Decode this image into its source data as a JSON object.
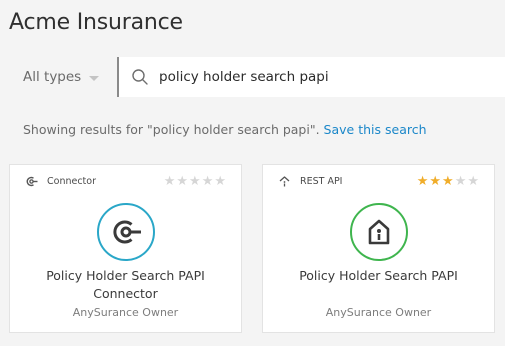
{
  "header": {
    "title": "Acme Insurance"
  },
  "filter": {
    "type_label": "All types"
  },
  "search": {
    "value": "policy holder search papi"
  },
  "results": {
    "prefix": "Showing results for \"policy holder search papi\". ",
    "save_label": "Save this search"
  },
  "cards": [
    {
      "type": "Connector",
      "type_icon": "connector-icon",
      "rating": 0,
      "max_rating": 5,
      "accent": "#2aa7c8",
      "name": "Policy Holder Search PAPI Connector",
      "owner": "AnySurance Owner"
    },
    {
      "type": "REST API",
      "type_icon": "rest-api-icon",
      "rating": 3,
      "max_rating": 5,
      "accent": "#3fb54e",
      "name": "Policy Holder Search PAPI",
      "owner": "AnySurance Owner"
    }
  ],
  "colors": {
    "link": "#1b87c9",
    "star_filled": "#f0ad2a",
    "star_empty": "#d6d6d6"
  }
}
